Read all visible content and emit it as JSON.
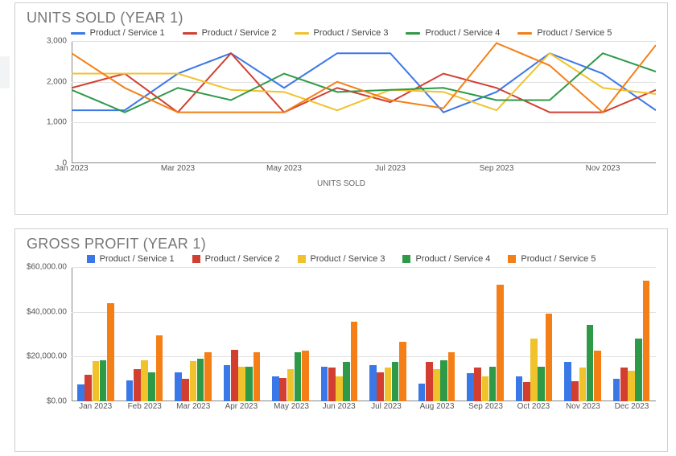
{
  "chart_data": [
    {
      "type": "line",
      "title": "UNITS SOLD (YEAR 1)",
      "xlabel": "UNITS SOLD",
      "ylabel": "",
      "ylim": [
        0,
        3000
      ],
      "yticks": [
        0,
        1000,
        2000,
        3000
      ],
      "categories": [
        "Jan 2023",
        "Feb 2023",
        "Mar 2023",
        "Apr 2023",
        "May 2023",
        "Jun 2023",
        "Jul 2023",
        "Aug 2023",
        "Sep 2023",
        "Oct 2023",
        "Nov 2023",
        "Dec 2023"
      ],
      "xTickShow": [
        0,
        2,
        4,
        6,
        8,
        10
      ],
      "series": [
        {
          "name": "Product / Service 1",
          "color": "#3b78e7",
          "values": [
            1300,
            1300,
            2200,
            2700,
            1850,
            2700,
            2700,
            1250,
            1750,
            2700,
            2200,
            1300
          ]
        },
        {
          "name": "Product / Service 2",
          "color": "#d23f31",
          "values": [
            1850,
            2200,
            1250,
            2700,
            1250,
            1850,
            1500,
            2200,
            1850,
            1250,
            1250,
            1800
          ]
        },
        {
          "name": "Product / Service 3",
          "color": "#f0c22b",
          "values": [
            2200,
            2200,
            2200,
            1800,
            1750,
            1300,
            1800,
            1750,
            1300,
            2700,
            1850,
            1700
          ]
        },
        {
          "name": "Product / Service 4",
          "color": "#2e9947",
          "values": [
            1800,
            1250,
            1850,
            1550,
            2200,
            1750,
            1800,
            1850,
            1550,
            1550,
            2700,
            2250
          ]
        },
        {
          "name": "Product / Service 5",
          "color": "#f47f16",
          "values": [
            2700,
            1850,
            1250,
            1250,
            1250,
            2000,
            1550,
            1350,
            2950,
            2400,
            1250,
            2900
          ]
        }
      ]
    },
    {
      "type": "bar",
      "title": "GROSS PROFIT (YEAR 1)",
      "xlabel": "",
      "ylabel": "",
      "ylim": [
        0,
        60000
      ],
      "yticks": [
        0,
        20000,
        40000,
        60000
      ],
      "yformat": "currency",
      "categories": [
        "Jan 2023",
        "Feb 2023",
        "Mar 2023",
        "Apr 2023",
        "May 2023",
        "Jun 2023",
        "Jul 2023",
        "Aug 2023",
        "Sep 2023",
        "Oct 2023",
        "Nov 2023",
        "Dec 2023"
      ],
      "series": [
        {
          "name": "Product / Service 1",
          "color": "#3b78e7",
          "values": [
            7500,
            9500,
            13000,
            16000,
            11000,
            15500,
            16000,
            8000,
            12500,
            11000,
            17500,
            10000
          ]
        },
        {
          "name": "Product / Service 2",
          "color": "#d23f31",
          "values": [
            12000,
            14500,
            10000,
            23000,
            10500,
            15000,
            13000,
            17500,
            15000,
            8500,
            9000,
            15000
          ]
        },
        {
          "name": "Product / Service 3",
          "color": "#f0c22b",
          "values": [
            18000,
            18500,
            18000,
            15500,
            14500,
            11000,
            15000,
            14500,
            11000,
            28000,
            15000,
            13500
          ]
        },
        {
          "name": "Product / Service 4",
          "color": "#2e9947",
          "values": [
            18500,
            13000,
            19000,
            15500,
            22000,
            17500,
            17500,
            18500,
            15500,
            15500,
            34000,
            28000
          ]
        },
        {
          "name": "Product / Service 5",
          "color": "#f47f16",
          "values": [
            44000,
            29500,
            22000,
            22000,
            22500,
            35500,
            26500,
            22000,
            52000,
            39000,
            22500,
            54000
          ]
        }
      ]
    }
  ]
}
